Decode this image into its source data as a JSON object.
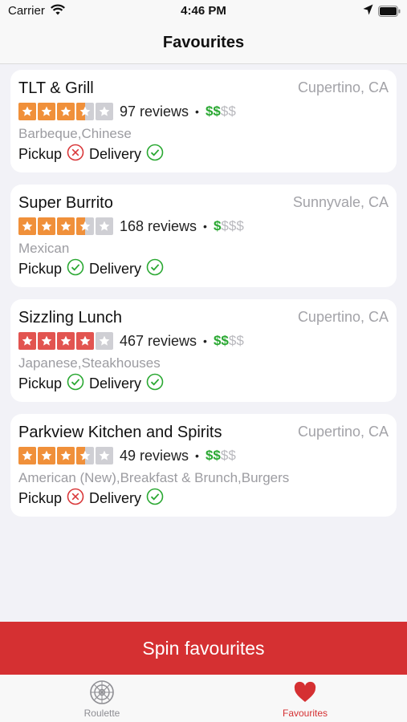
{
  "status_bar": {
    "carrier": "Carrier",
    "time": "4:46 PM",
    "icons": [
      "wifi-icon",
      "location-arrow-icon",
      "battery-icon"
    ]
  },
  "nav": {
    "title": "Favourites"
  },
  "colors": {
    "star_orange": "#f0903a",
    "star_red": "#e25450",
    "star_empty": "#cfcfd4",
    "price_active": "#2aa832",
    "accent": "#d53032",
    "cross": "#d9383a",
    "check": "#2aa832"
  },
  "favourites": [
    {
      "name": "TLT & Grill",
      "city": "Cupertino, CA",
      "rating": 3.5,
      "star_color": "orange",
      "reviews": "97 reviews",
      "price_active": "$$",
      "price_inactive": "$$",
      "categories": "Barbeque,Chinese",
      "pickup_label": "Pickup",
      "pickup": false,
      "delivery_label": "Delivery",
      "delivery": true
    },
    {
      "name": "Super Burrito",
      "city": "Sunnyvale, CA",
      "rating": 3.5,
      "star_color": "orange",
      "reviews": "168 reviews",
      "price_active": "$",
      "price_inactive": "$$$",
      "categories": "Mexican",
      "pickup_label": "Pickup",
      "pickup": true,
      "delivery_label": "Delivery",
      "delivery": true
    },
    {
      "name": "Sizzling Lunch",
      "city": "Cupertino, CA",
      "rating": 4,
      "star_color": "red",
      "reviews": "467 reviews",
      "price_active": "$$",
      "price_inactive": "$$",
      "categories": "Japanese,Steakhouses",
      "pickup_label": "Pickup",
      "pickup": true,
      "delivery_label": "Delivery",
      "delivery": true
    },
    {
      "name": "Parkview Kitchen and Spirits",
      "city": "Cupertino, CA",
      "rating": 3.5,
      "star_color": "orange",
      "reviews": "49 reviews",
      "price_active": "$$",
      "price_inactive": "$$",
      "categories": "American (New),Breakfast & Brunch,Burgers",
      "pickup_label": "Pickup",
      "pickup": false,
      "delivery_label": "Delivery",
      "delivery": true
    }
  ],
  "spin_button": {
    "label": "Spin favourites"
  },
  "tabs": [
    {
      "label": "Roulette",
      "icon": "roulette-wheel-icon",
      "active": false
    },
    {
      "label": "Favourites",
      "icon": "heart-icon",
      "active": true
    }
  ]
}
